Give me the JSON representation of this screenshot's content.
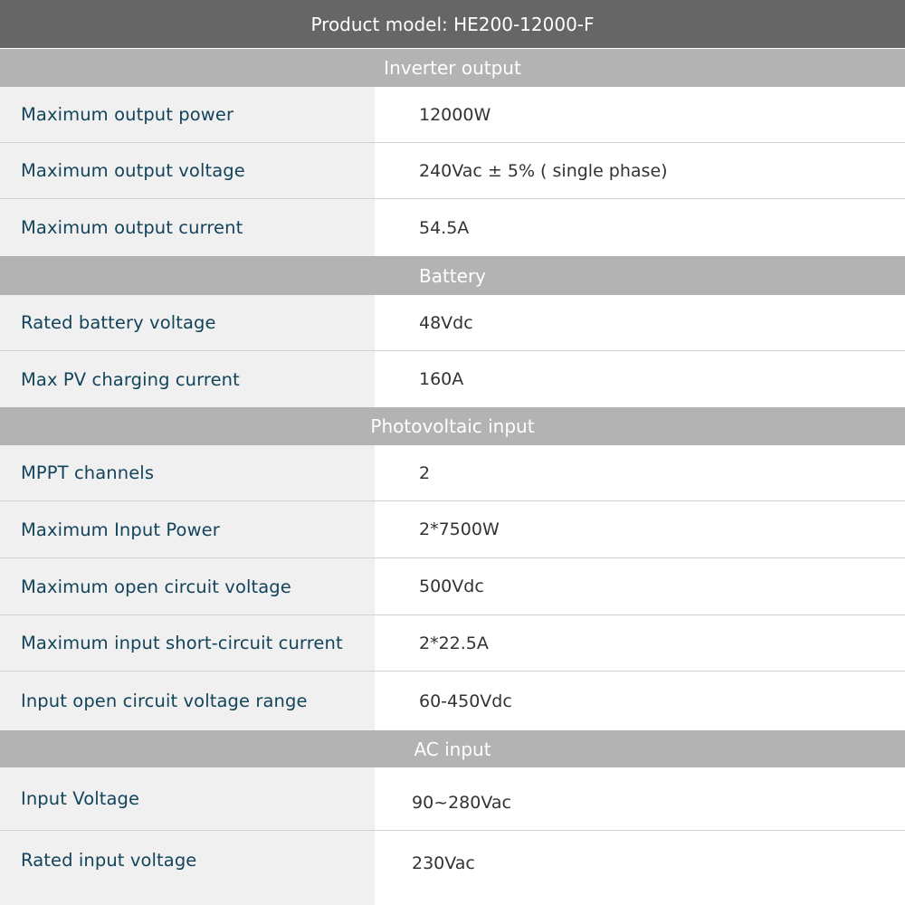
{
  "title": "Product model: HE200-12000-F",
  "sections": [
    {
      "header": "Inverter output",
      "rows": [
        {
          "label": "Maximum output power",
          "value": "12000W"
        },
        {
          "label": "Maximum output voltage",
          "value": "240Vac ± 5% ( single phase)"
        },
        {
          "label": "Maximum output current",
          "value": "54.5A"
        }
      ]
    },
    {
      "header": "Battery",
      "rows": [
        {
          "label": "Rated battery voltage",
          "value": "48Vdc"
        },
        {
          "label": "Max PV charging current",
          "value": "160A"
        }
      ]
    },
    {
      "header": "Photovoltaic input",
      "rows": [
        {
          "label": "MPPT channels",
          "value": "2"
        },
        {
          "label": "Maximum Input Power",
          "value": "2*7500W"
        },
        {
          "label": "Maximum open circuit voltage",
          "value": "500Vdc"
        },
        {
          "label": "Maximum input short-circuit current",
          "value": "2*22.5A"
        },
        {
          "label": "Input open circuit voltage range",
          "value": "60-450Vdc"
        }
      ]
    },
    {
      "header": "AC input",
      "rows": [
        {
          "label": "Input Voltage",
          "value": "90~280Vac"
        },
        {
          "label": "Rated input voltage",
          "value": "230Vac"
        }
      ]
    }
  ]
}
